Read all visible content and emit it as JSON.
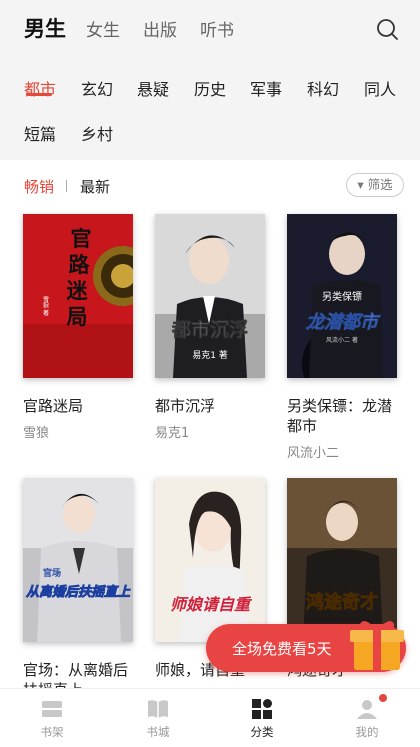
{
  "header": {
    "tabs": [
      {
        "label": "男生"
      },
      {
        "label": "女生"
      },
      {
        "label": "出版"
      },
      {
        "label": "听书"
      }
    ]
  },
  "categories": [
    {
      "label": "都市"
    },
    {
      "label": "玄幻"
    },
    {
      "label": "悬疑"
    },
    {
      "label": "历史"
    },
    {
      "label": "军事"
    },
    {
      "label": "科幻"
    },
    {
      "label": "同人"
    },
    {
      "label": "短篇"
    },
    {
      "label": "乡村"
    }
  ],
  "sort": {
    "items": [
      {
        "label": "畅销"
      },
      {
        "label": "最新"
      }
    ],
    "filter_label": "▾ 筛选"
  },
  "books": [
    {
      "title": "官路迷局",
      "author": "雪狼",
      "cover_text": "官路迷局",
      "cover_author": "雪狼 著"
    },
    {
      "title": "都市沉浮",
      "author": "易克1",
      "cover_text": "都市沉浮",
      "cover_author": "易克1 著"
    },
    {
      "title": "另类保镖：龙潜都市",
      "author": "风流小二",
      "cover_text": "龙潜都市",
      "cover_sub": "另类保镖",
      "cover_author": "风流小二 著"
    },
    {
      "title": "官场：从离婚后扶摇直上",
      "author": "",
      "cover_text": "从离婚后扶摇直上",
      "cover_sub": "官场"
    },
    {
      "title": "师娘，请自重",
      "author": "",
      "cover_text": "师娘请自重"
    },
    {
      "title": "鸿途奇才",
      "author": "",
      "cover_text": "鸿途奇才"
    }
  ],
  "promo": {
    "label": "全场免费看5天"
  },
  "bottom_nav": [
    {
      "label": "书架",
      "icon": "bookshelf-icon"
    },
    {
      "label": "书城",
      "icon": "book-icon"
    },
    {
      "label": "分类",
      "icon": "category-icon"
    },
    {
      "label": "我的",
      "icon": "user-icon"
    }
  ],
  "colors": {
    "accent": "#e4483b",
    "promo": "#e84444"
  }
}
